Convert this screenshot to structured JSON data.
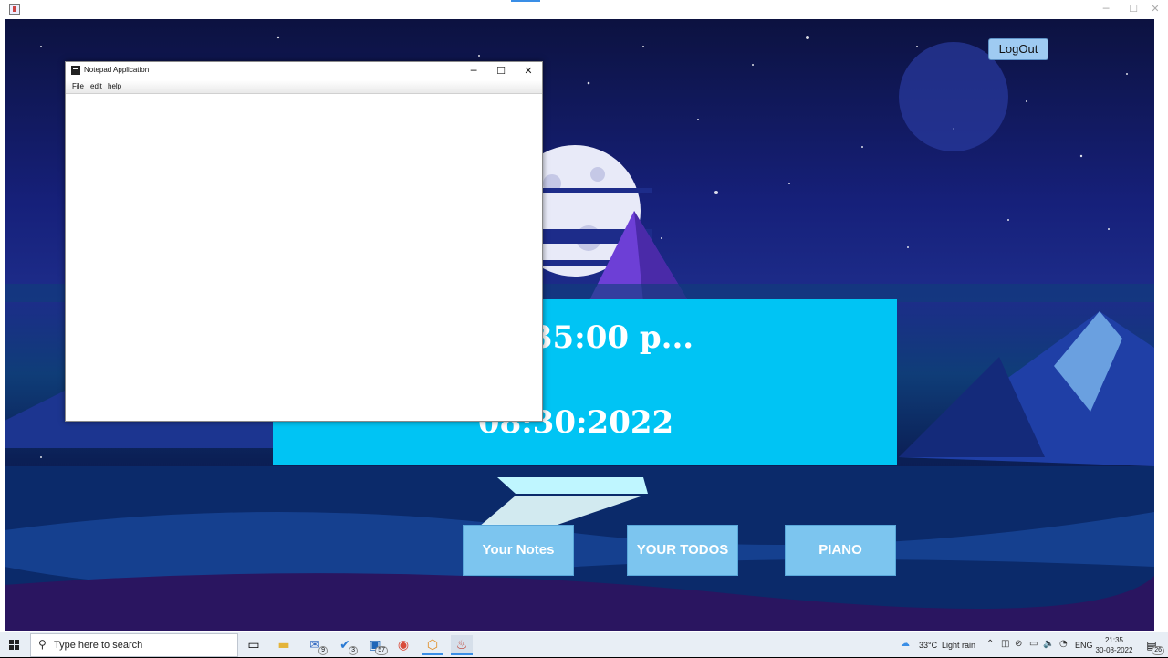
{
  "notepad": {
    "title": "Notepad Application",
    "menu": [
      "File",
      "edit",
      "help"
    ],
    "controls": {
      "minimize": "─",
      "maximize": "☐",
      "close": "✕"
    }
  },
  "outer_window": {
    "controls": {
      "minimize": "─",
      "maximize": "☐",
      "close": "✕"
    }
  },
  "dashboard": {
    "logout_label": "LogOut",
    "time_text": "35:00 p...",
    "date_text": "08:30:2022",
    "buttons": [
      "Your Notes",
      "YOUR TODOS",
      "PIANO"
    ],
    "colors": {
      "clock_panel": "#00c4f4",
      "button": "#7cc5ef",
      "logout": "#9fcbf2"
    }
  },
  "taskbar": {
    "search_placeholder": "Type here to search",
    "badges": {
      "mail": "9",
      "todo": "3",
      "app": "57"
    },
    "weather": {
      "temp": "33°C",
      "desc": "Light rain"
    },
    "language": "ENG",
    "time": "21:35",
    "date": "30-08-2022",
    "notifications": "26"
  }
}
